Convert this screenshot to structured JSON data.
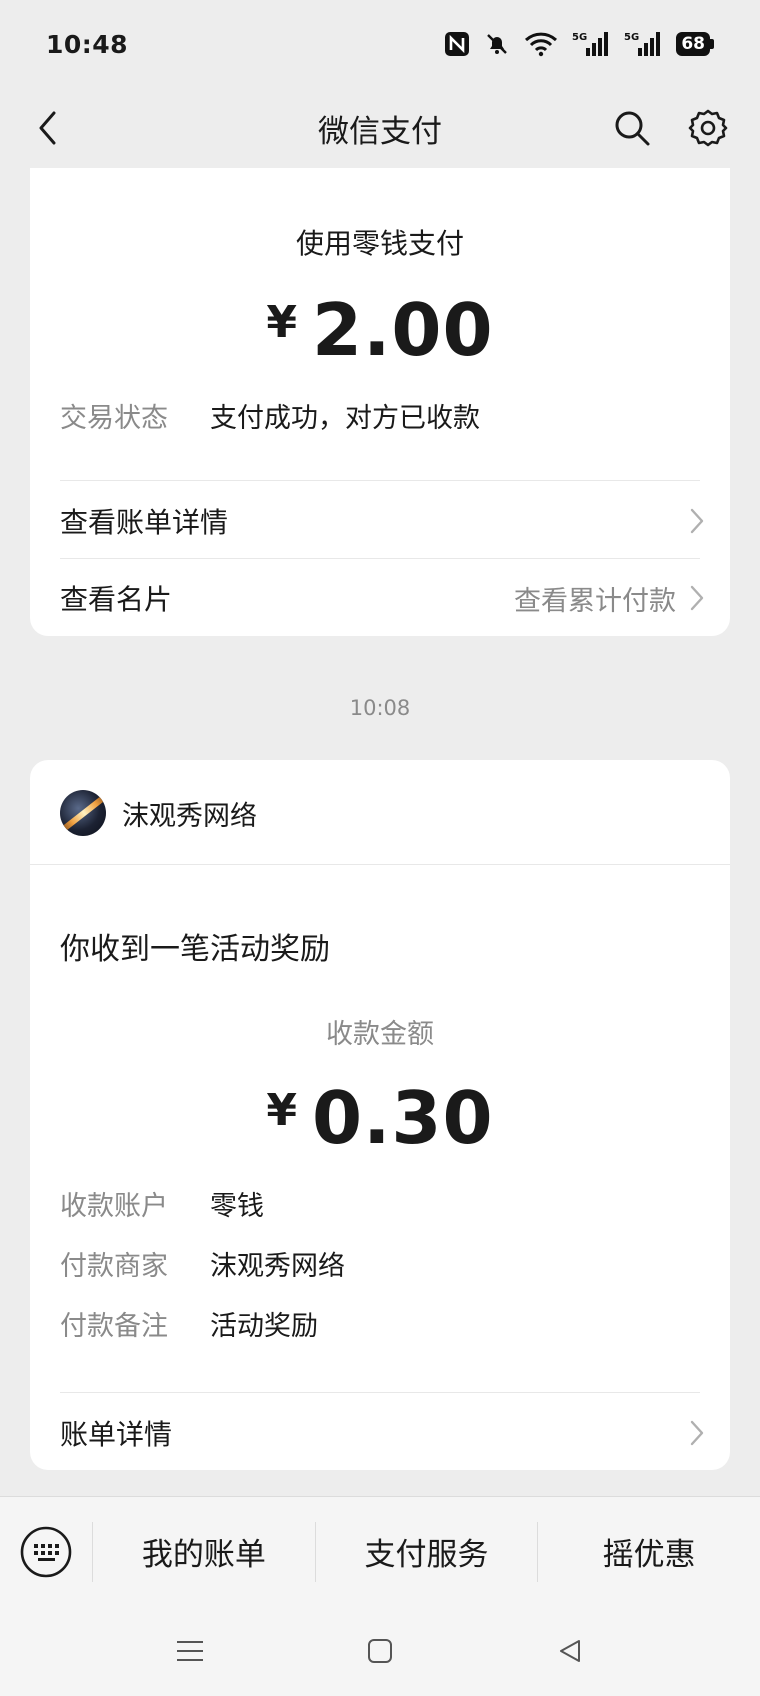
{
  "status_bar": {
    "time": "10:48",
    "battery": "68",
    "icons": [
      "nfc-icon",
      "bell-muted-icon",
      "wifi-icon",
      "signal-5g-icon",
      "signal-5g-icon"
    ]
  },
  "nav": {
    "title": "微信支付",
    "icons": [
      "back-icon",
      "search-icon",
      "gear-icon"
    ]
  },
  "payment_card": {
    "method_label": "使用零钱支付",
    "currency": "¥",
    "amount": "2.00",
    "status_key": "交易状态",
    "status_value": "支付成功，对方已收款",
    "bill_detail_label": "查看账单详情",
    "card_label": "查看名片",
    "cumulative_label": "查看累计付款"
  },
  "timestamp": "10:08",
  "reward_card": {
    "merchant_name": "沫观秀网络",
    "title": "你收到一笔活动奖励",
    "amount_label": "收款金额",
    "currency": "¥",
    "amount": "0.30",
    "rows": [
      {
        "key": "收款账户",
        "value": "零钱"
      },
      {
        "key": "付款商家",
        "value": "沫观秀网络"
      },
      {
        "key": "付款备注",
        "value": "活动奖励"
      }
    ],
    "bill_detail_label": "账单详情"
  },
  "bottom_menu": {
    "items": [
      "我的账单",
      "支付服务",
      "摇优惠"
    ]
  },
  "colors": {
    "background": "#ededed",
    "card": "#ffffff",
    "muted_text": "#8a8a8a"
  }
}
